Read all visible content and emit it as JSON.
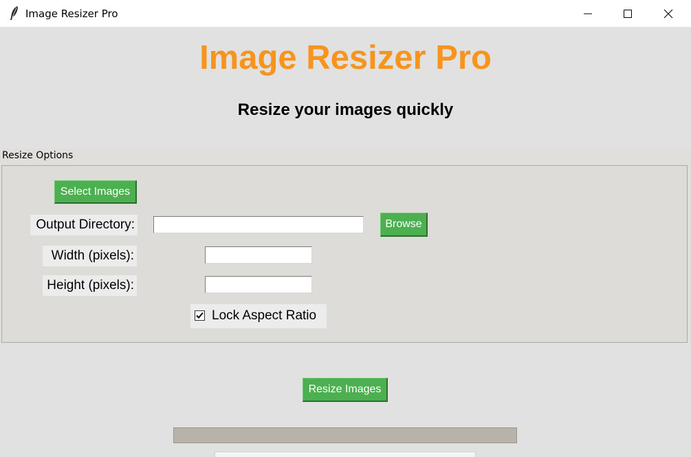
{
  "window": {
    "title": "Image Resizer Pro",
    "icon": "feather-icon"
  },
  "header": {
    "title": "Image Resizer Pro",
    "subtitle": "Resize your images quickly",
    "title_color": "#f7941d"
  },
  "options": {
    "frame_label": "Resize Options",
    "select_images_label": "Select Images",
    "output_dir_label": "Output Directory:",
    "output_dir_value": "",
    "browse_label": "Browse",
    "width_label": "Width (pixels):",
    "width_value": "",
    "height_label": "Height (pixels):",
    "height_value": "",
    "lock_aspect_label": "Lock Aspect Ratio",
    "lock_aspect_checked": true
  },
  "actions": {
    "resize_label": "Resize Images",
    "button_color": "#4caf50"
  },
  "progress": {
    "value_percent": 0
  }
}
